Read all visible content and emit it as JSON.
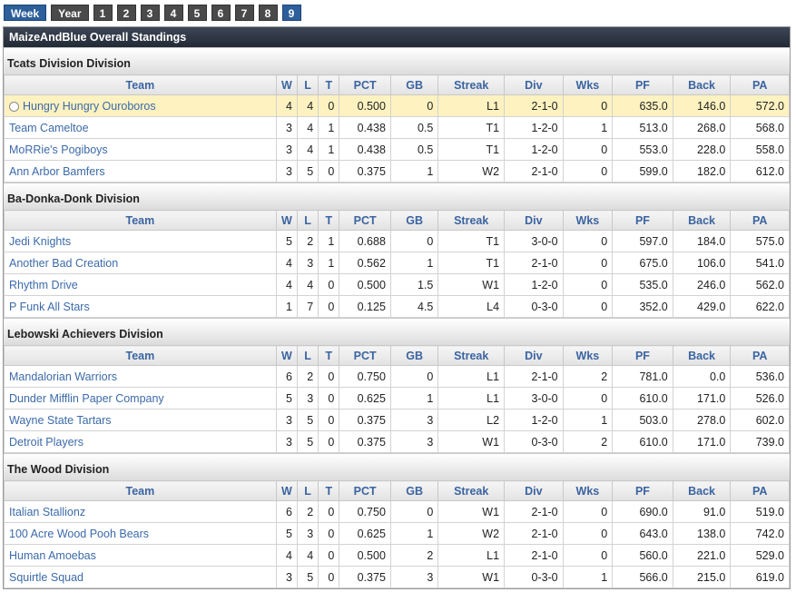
{
  "nav": {
    "tabs": [
      {
        "label": "Week",
        "active": true
      },
      {
        "label": "Year",
        "active": false
      }
    ],
    "weeks": [
      "1",
      "2",
      "3",
      "4",
      "5",
      "6",
      "7",
      "8",
      "9"
    ],
    "active_week": "9"
  },
  "title": "MaizeAndBlue Overall Standings",
  "columns": [
    "Team",
    "W",
    "L",
    "T",
    "PCT",
    "GB",
    "Streak",
    "Div",
    "Wks",
    "PF",
    "Back",
    "PA"
  ],
  "divisions": [
    {
      "name": "Tcats Division Division",
      "rows": [
        {
          "team": "Hungry Hungry Ouroboros",
          "w": "4",
          "l": "4",
          "t": "0",
          "pct": "0.500",
          "gb": "0",
          "streak": "L1",
          "div": "2-1-0",
          "wks": "0",
          "pf": "635.0",
          "back": "146.0",
          "pa": "572.0",
          "highlight": true
        },
        {
          "team": "Team Cameltoe",
          "w": "3",
          "l": "4",
          "t": "1",
          "pct": "0.438",
          "gb": "0.5",
          "streak": "T1",
          "div": "1-2-0",
          "wks": "1",
          "pf": "513.0",
          "back": "268.0",
          "pa": "568.0"
        },
        {
          "team": "MoRRie's Pogiboys",
          "w": "3",
          "l": "4",
          "t": "1",
          "pct": "0.438",
          "gb": "0.5",
          "streak": "T1",
          "div": "1-2-0",
          "wks": "0",
          "pf": "553.0",
          "back": "228.0",
          "pa": "558.0"
        },
        {
          "team": "Ann Arbor Bamfers",
          "w": "3",
          "l": "5",
          "t": "0",
          "pct": "0.375",
          "gb": "1",
          "streak": "W2",
          "div": "2-1-0",
          "wks": "0",
          "pf": "599.0",
          "back": "182.0",
          "pa": "612.0"
        }
      ]
    },
    {
      "name": "Ba-Donka-Donk Division",
      "rows": [
        {
          "team": "Jedi Knights",
          "w": "5",
          "l": "2",
          "t": "1",
          "pct": "0.688",
          "gb": "0",
          "streak": "T1",
          "div": "3-0-0",
          "wks": "0",
          "pf": "597.0",
          "back": "184.0",
          "pa": "575.0"
        },
        {
          "team": "Another Bad Creation",
          "w": "4",
          "l": "3",
          "t": "1",
          "pct": "0.562",
          "gb": "1",
          "streak": "T1",
          "div": "2-1-0",
          "wks": "0",
          "pf": "675.0",
          "back": "106.0",
          "pa": "541.0"
        },
        {
          "team": "Rhythm Drive",
          "w": "4",
          "l": "4",
          "t": "0",
          "pct": "0.500",
          "gb": "1.5",
          "streak": "W1",
          "div": "1-2-0",
          "wks": "0",
          "pf": "535.0",
          "back": "246.0",
          "pa": "562.0"
        },
        {
          "team": "P Funk All Stars",
          "w": "1",
          "l": "7",
          "t": "0",
          "pct": "0.125",
          "gb": "4.5",
          "streak": "L4",
          "div": "0-3-0",
          "wks": "0",
          "pf": "352.0",
          "back": "429.0",
          "pa": "622.0"
        }
      ]
    },
    {
      "name": "Lebowski Achievers Division",
      "rows": [
        {
          "team": "Mandalorian Warriors",
          "w": "6",
          "l": "2",
          "t": "0",
          "pct": "0.750",
          "gb": "0",
          "streak": "L1",
          "div": "2-1-0",
          "wks": "2",
          "pf": "781.0",
          "back": "0.0",
          "pa": "536.0"
        },
        {
          "team": "Dunder Mifflin Paper Company",
          "w": "5",
          "l": "3",
          "t": "0",
          "pct": "0.625",
          "gb": "1",
          "streak": "L1",
          "div": "3-0-0",
          "wks": "0",
          "pf": "610.0",
          "back": "171.0",
          "pa": "526.0"
        },
        {
          "team": "Wayne State Tartars",
          "w": "3",
          "l": "5",
          "t": "0",
          "pct": "0.375",
          "gb": "3",
          "streak": "L2",
          "div": "1-2-0",
          "wks": "1",
          "pf": "503.0",
          "back": "278.0",
          "pa": "602.0"
        },
        {
          "team": "Detroit Players",
          "w": "3",
          "l": "5",
          "t": "0",
          "pct": "0.375",
          "gb": "3",
          "streak": "W1",
          "div": "0-3-0",
          "wks": "2",
          "pf": "610.0",
          "back": "171.0",
          "pa": "739.0"
        }
      ]
    },
    {
      "name": "The Wood Division",
      "rows": [
        {
          "team": "Italian Stallionz",
          "w": "6",
          "l": "2",
          "t": "0",
          "pct": "0.750",
          "gb": "0",
          "streak": "W1",
          "div": "2-1-0",
          "wks": "0",
          "pf": "690.0",
          "back": "91.0",
          "pa": "519.0"
        },
        {
          "team": "100 Acre Wood Pooh Bears",
          "w": "5",
          "l": "3",
          "t": "0",
          "pct": "0.625",
          "gb": "1",
          "streak": "W2",
          "div": "2-1-0",
          "wks": "0",
          "pf": "643.0",
          "back": "138.0",
          "pa": "742.0"
        },
        {
          "team": "Human Amoebas",
          "w": "4",
          "l": "4",
          "t": "0",
          "pct": "0.500",
          "gb": "2",
          "streak": "L1",
          "div": "2-1-0",
          "wks": "0",
          "pf": "560.0",
          "back": "221.0",
          "pa": "529.0"
        },
        {
          "team": "Squirtle Squad",
          "w": "3",
          "l": "5",
          "t": "0",
          "pct": "0.375",
          "gb": "3",
          "streak": "W1",
          "div": "0-3-0",
          "wks": "1",
          "pf": "566.0",
          "back": "215.0",
          "pa": "619.0"
        }
      ]
    }
  ],
  "colors": {
    "link": "#3c6aaa",
    "highlight_row": "#fdf2c0",
    "active_tab": "#2d5f9a",
    "tab": "#4a4a4a",
    "title_bar": "#2b3240"
  }
}
